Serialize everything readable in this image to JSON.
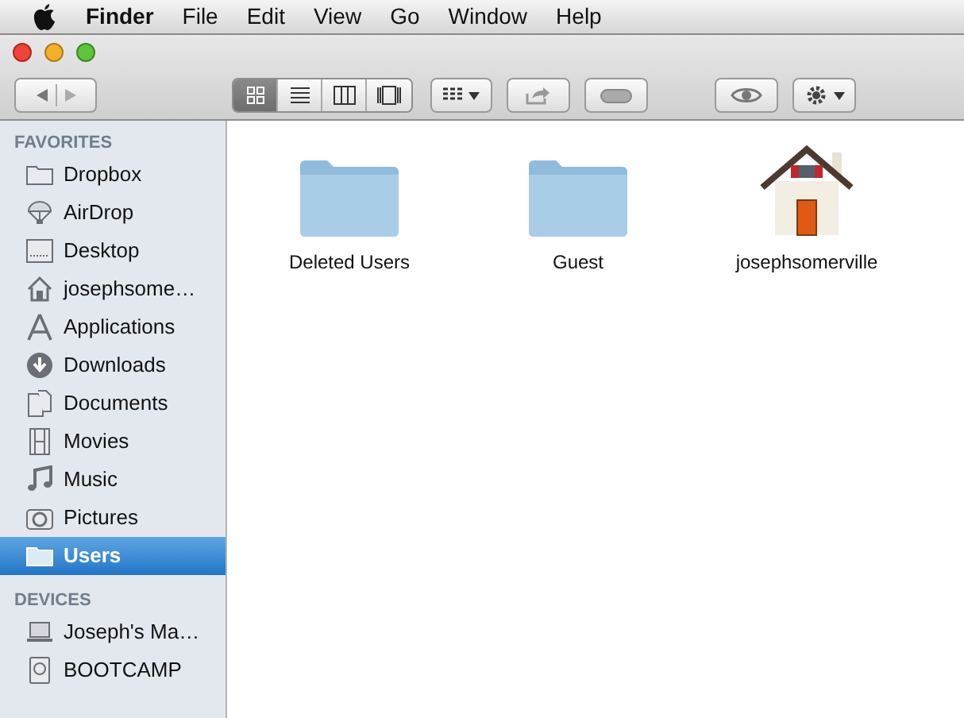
{
  "menu_bar": {
    "items": [
      {
        "label": "Finder",
        "bold": true
      },
      {
        "label": "File",
        "bold": false
      },
      {
        "label": "Edit",
        "bold": false
      },
      {
        "label": "View",
        "bold": false
      },
      {
        "label": "Go",
        "bold": false
      },
      {
        "label": "Window",
        "bold": false
      },
      {
        "label": "Help",
        "bold": false
      }
    ]
  },
  "toolbar": {
    "view_modes": [
      {
        "kind": "icons",
        "selected": true
      },
      {
        "kind": "list",
        "selected": false
      },
      {
        "kind": "columns",
        "selected": false
      },
      {
        "kind": "coverflow",
        "selected": false
      }
    ]
  },
  "sidebar": {
    "sections": [
      {
        "title": "FAVORITES",
        "items": [
          {
            "label": "Dropbox",
            "kind": "folder",
            "selected": false
          },
          {
            "label": "AirDrop",
            "kind": "airdrop",
            "selected": false
          },
          {
            "label": "Desktop",
            "kind": "desktop",
            "selected": false
          },
          {
            "label": "josephsome…",
            "kind": "home",
            "selected": false
          },
          {
            "label": "Applications",
            "kind": "apps",
            "selected": false
          },
          {
            "label": "Downloads",
            "kind": "download",
            "selected": false
          },
          {
            "label": "Documents",
            "kind": "documents",
            "selected": false
          },
          {
            "label": "Movies",
            "kind": "film",
            "selected": false
          },
          {
            "label": "Music",
            "kind": "music",
            "selected": false
          },
          {
            "label": "Pictures",
            "kind": "camera",
            "selected": false
          },
          {
            "label": "Users",
            "kind": "folder",
            "selected": true
          }
        ]
      },
      {
        "title": "DEVICES",
        "items": [
          {
            "label": "Joseph's Ma…",
            "kind": "laptop",
            "selected": false
          },
          {
            "label": "BOOTCAMP",
            "kind": "disk",
            "selected": false
          }
        ]
      }
    ]
  },
  "files": [
    {
      "name": "Deleted Users",
      "kind": "folder"
    },
    {
      "name": "Guest",
      "kind": "folder"
    },
    {
      "name": "josephsomerville",
      "kind": "home"
    }
  ]
}
